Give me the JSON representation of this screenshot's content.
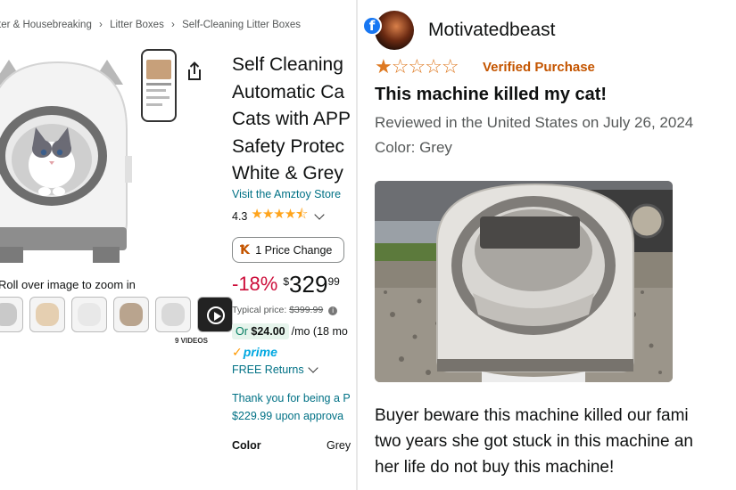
{
  "product": {
    "breadcrumb": [
      "ter & Housebreaking",
      "Litter Boxes",
      "Self-Cleaning Litter Boxes"
    ],
    "breadcrumb_sep": "›",
    "title_lines": [
      "Self Cleaning",
      "Automatic Ca",
      "Cats with APP",
      "Safety Protec",
      "White & Grey"
    ],
    "store_link": "Visit the Amztoy Store",
    "rating_value": "4.3",
    "rating_stars": "★★★★⯪",
    "price_change_icon": "Ꝁ",
    "price_change_label": "1 Price Change",
    "discount": "-18%",
    "price_symbol": "$",
    "price_whole": "329",
    "price_fraction": "99",
    "typical_label": "Typical price:",
    "typical_price": "$399.99",
    "info_icon": "i",
    "monthly_prefix": "Or",
    "monthly_amount": "$24.00",
    "monthly_rest": "/mo (18 mo",
    "prime_check": "✓",
    "prime_label": "prime",
    "free_returns": "FREE Returns",
    "thanks_line1": "Thank you for being a P",
    "thanks_line2": "$229.99 upon approva",
    "color_label": "Color",
    "color_value": "Grey",
    "zoom_hint": "Roll over image to zoom in",
    "videos_label": "9 VIDEOS",
    "accent_orange": "#ffa41c",
    "discount_red": "#cc0c39",
    "link_teal": "#007185"
  },
  "review": {
    "reviewer_name": "Motivatedbeast",
    "fb_icon": "f",
    "rating_filled": "★",
    "rating_empty": "☆☆☆☆",
    "verified_label": "Verified Purchase",
    "title": "This machine killed my cat!",
    "date": "Reviewed in the United States on July 26, 2024",
    "color": "Color: Grey",
    "body_lines": [
      "Buyer beware this machine killed our fami",
      "two years she got stuck in this machine an",
      "her life do not buy this machine!"
    ],
    "star_color": "#de7921",
    "verified_color": "#c45500"
  }
}
